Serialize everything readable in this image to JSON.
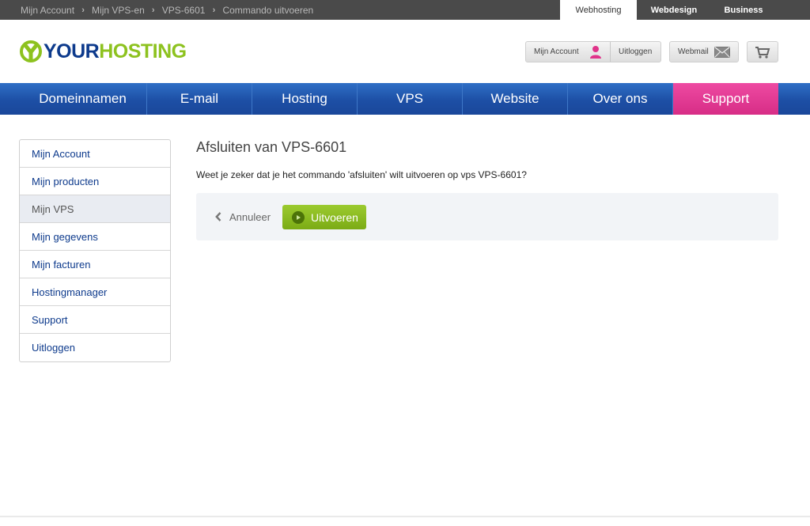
{
  "breadcrumb": {
    "items": [
      "Mijn Account",
      "Mijn VPS-en",
      "VPS-6601",
      "Commando uitvoeren"
    ],
    "separator": "›"
  },
  "site_tabs": [
    "Webhosting",
    "Webdesign",
    "Business"
  ],
  "logo": {
    "part1": "YOUR",
    "part2": "HOSTING",
    "icon": "y-logo-icon"
  },
  "header_buttons": {
    "account_label": "Mijn Account",
    "account_icon": "user-icon",
    "logout_label": "Uitloggen",
    "webmail_label": "Webmail",
    "webmail_icon": "envelope-icon",
    "cart_icon": "shopping-cart-icon"
  },
  "nav": {
    "items": [
      "Domeinnamen",
      "E-mail",
      "Hosting",
      "VPS",
      "Website",
      "Over ons",
      "Support"
    ]
  },
  "sidebar": {
    "items": [
      {
        "label": "Mijn Account"
      },
      {
        "label": "Mijn producten"
      },
      {
        "label": "Mijn VPS",
        "active": true
      },
      {
        "label": "Mijn gegevens"
      },
      {
        "label": "Mijn facturen"
      },
      {
        "label": "Hostingmanager"
      },
      {
        "label": "Support"
      },
      {
        "label": "Uitloggen"
      }
    ]
  },
  "main": {
    "title": "Afsluiten van VPS-6601",
    "question": "Weet je zeker dat je het commando 'afsluiten' wilt uitvoeren op vps VPS-6601?",
    "cancel_label": "Annuleer",
    "cancel_icon": "chevron-left-icon",
    "run_label": "Uitvoeren",
    "run_icon": "play-icon"
  },
  "colors": {
    "brand_blue": "#0d3a8c",
    "brand_green": "#8dc21f",
    "nav_blue": "#1d4fa5",
    "support_pink": "#e03a92",
    "accent_user": "#e0338a"
  }
}
